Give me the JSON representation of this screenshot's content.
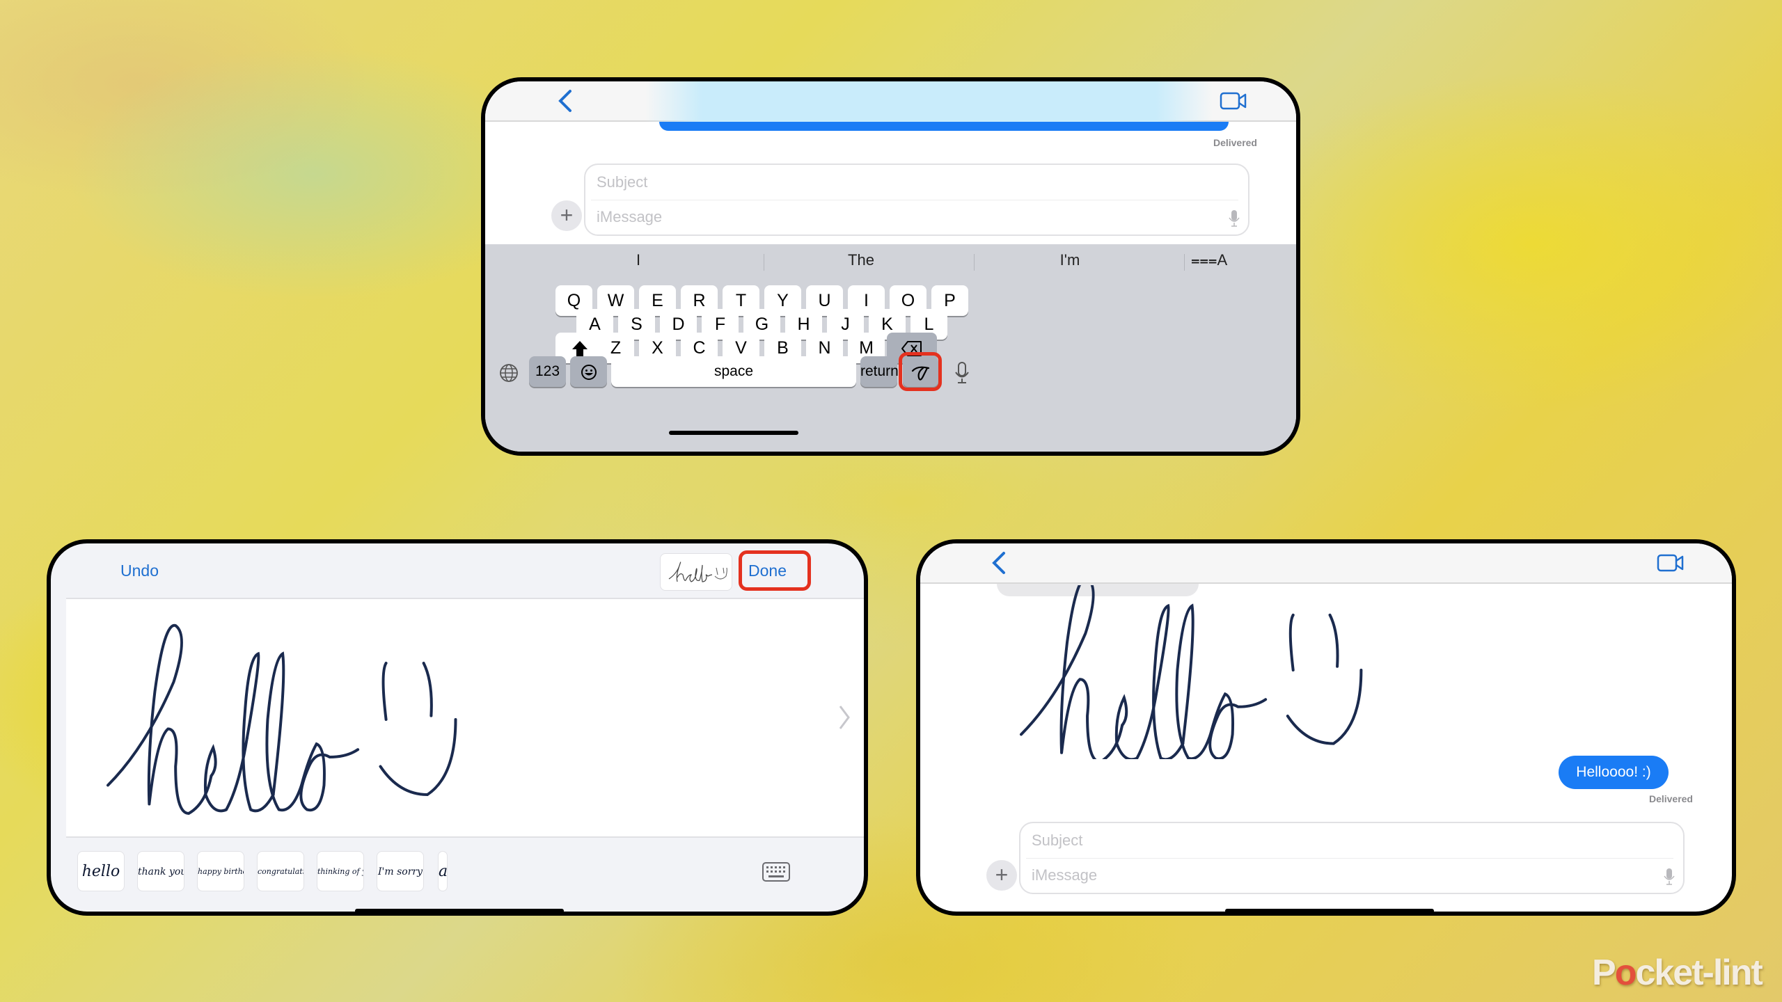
{
  "top_phone": {
    "nav": {
      "back_icon": "chevron-left-icon",
      "video_icon": "video-camera-icon"
    },
    "delivered_label": "Delivered",
    "compose": {
      "subject_placeholder": "Subject",
      "message_placeholder": "iMessage",
      "add_icon": "+",
      "mic_icon": "mic-icon"
    },
    "predictions": [
      "I",
      "The",
      "I'm"
    ],
    "format_icon": "⩶A",
    "keys": {
      "row1": [
        "Q",
        "W",
        "E",
        "R",
        "T",
        "Y",
        "U",
        "I",
        "O",
        "P"
      ],
      "row2": [
        "A",
        "S",
        "D",
        "F",
        "G",
        "H",
        "J",
        "K",
        "L"
      ],
      "row3": [
        "Z",
        "X",
        "C",
        "V",
        "B",
        "N",
        "M"
      ],
      "shift_icon": "shift-icon",
      "delete_icon": "delete-icon",
      "numbers_label": "123",
      "emoji_icon": "emoji-icon",
      "space_label": "space",
      "return_label": "return",
      "handwriting_icon": "handwriting-icon",
      "globe_icon": "globe-icon",
      "dictation_icon": "mic-icon"
    },
    "highlight_color": "#e4311f"
  },
  "left_panel": {
    "undo_label": "Undo",
    "done_label": "Done",
    "preview_text": "hello :)",
    "canvas_drawing": "hello :)",
    "phrases": [
      "hello",
      "thank you",
      "happy birthday",
      "congratulations",
      "thinking of you",
      "I'm sorry",
      "a"
    ],
    "keyboard_icon": "keyboard-icon",
    "highlight_color": "#e4311f"
  },
  "right_panel": {
    "nav": {
      "back_icon": "chevron-left-icon",
      "video_icon": "video-camera-icon"
    },
    "handwritten_message": "hello :)",
    "sent_message": "Helloooo! :)",
    "delivered_label": "Delivered",
    "compose": {
      "subject_placeholder": "Subject",
      "message_placeholder": "iMessage"
    }
  },
  "colors": {
    "ios_blue": "#1a7cf5",
    "link_blue": "#1f6fd0",
    "ink": "#1a2a4e"
  },
  "watermark": {
    "brand_pre": "P",
    "brand_o": "o",
    "brand_post": "cket-lint"
  }
}
